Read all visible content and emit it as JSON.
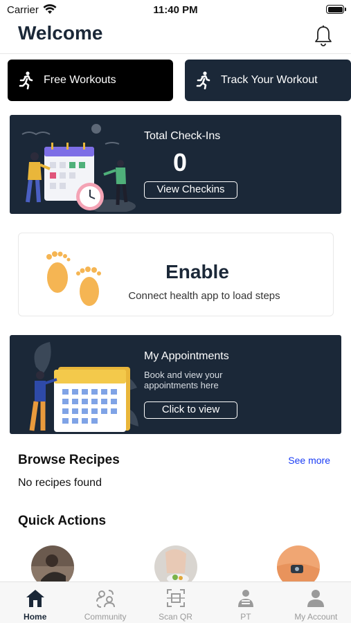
{
  "status_bar": {
    "carrier": "Carrier",
    "time": "11:40 PM"
  },
  "header": {
    "title": "Welcome",
    "bell_icon": "bell-icon"
  },
  "workouts": {
    "free_label": "Free Workouts",
    "track_label": "Track Your Workout",
    "icon": "running-person-icon"
  },
  "checkins": {
    "heading": "Total Check-Ins",
    "count": "0",
    "button": "View Checkins"
  },
  "steps": {
    "title": "Enable",
    "subtitle": "Connect health app to load steps",
    "icon": "footprints-icon"
  },
  "appointments": {
    "heading": "My Appointments",
    "subtitle": "Book and view your appointments here",
    "button": "Click to view"
  },
  "recipes": {
    "title": "Browse Recipes",
    "see_more": "See more",
    "empty": "No recipes found"
  },
  "quick_actions": {
    "title": "Quick Actions"
  },
  "tabbar": {
    "tabs": [
      {
        "label": "Home",
        "icon": "home-icon",
        "active": true
      },
      {
        "label": "Community",
        "icon": "community-icon",
        "active": false
      },
      {
        "label": "Scan QR",
        "icon": "scan-qr-icon",
        "active": false
      },
      {
        "label": "PT",
        "icon": "trainer-icon",
        "active": false
      },
      {
        "label": "My Account",
        "icon": "account-icon",
        "active": false
      }
    ]
  },
  "colors": {
    "navy": "#1b2838",
    "link": "#1a3cf5",
    "black": "#000000"
  }
}
